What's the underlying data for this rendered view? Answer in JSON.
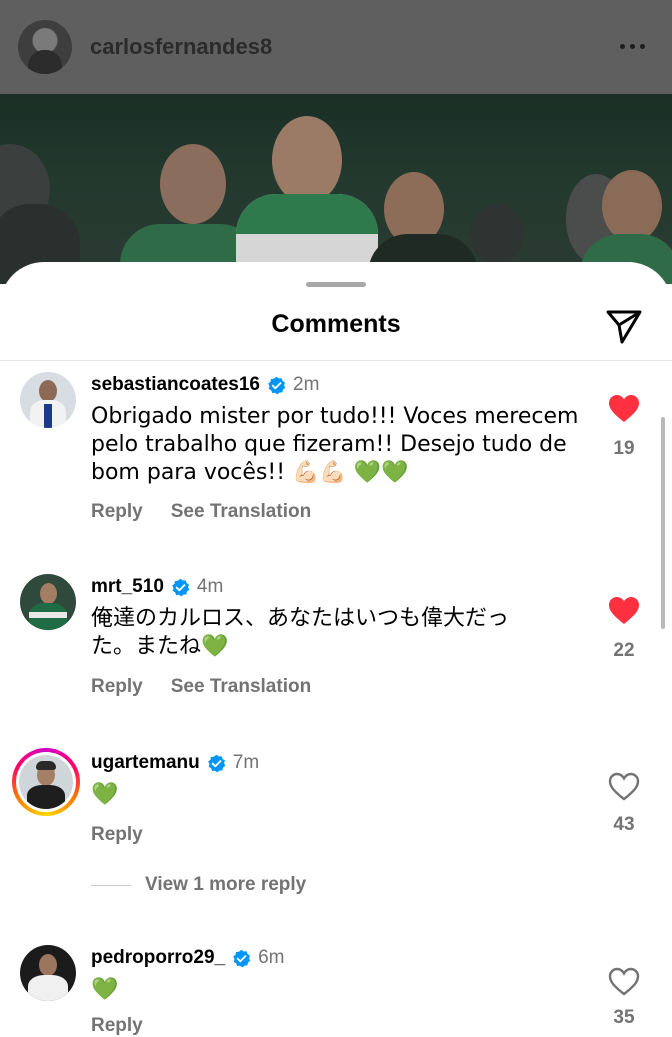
{
  "post": {
    "username": "carlosfernandes8",
    "more_icon": "more-horizontal-icon"
  },
  "sheet": {
    "title": "Comments",
    "share_icon": "send-icon"
  },
  "colors": {
    "like_red": "#ff3040",
    "verified_blue": "#0095f6",
    "secondary_text": "#737373"
  },
  "comments": [
    {
      "username": "sebastiancoates16",
      "verified": true,
      "time": "2m",
      "text_lines": [
        "Obrigado mister por tudo!!! Voces merecem",
        "pelo trabalho que fizeram!! Desejo tudo de",
        "bom para vocês!! 💪🏻💪🏻 💚💚"
      ],
      "reply_label": "Reply",
      "translate_label": "See Translation",
      "liked": true,
      "likes": "19"
    },
    {
      "username": "mrt_510",
      "verified": true,
      "time": "4m",
      "text_lines": [
        "俺達のカルロス、あなたはいつも偉大だっ",
        "た。またね💚"
      ],
      "reply_label": "Reply",
      "translate_label": "See Translation",
      "liked": true,
      "likes": "22"
    },
    {
      "username": "ugartemanu",
      "verified": true,
      "time": "7m",
      "text_lines": [
        "💚"
      ],
      "reply_label": "Reply",
      "liked": false,
      "likes": "43",
      "view_replies": "View 1 more reply"
    },
    {
      "username": "pedroporro29_",
      "verified": true,
      "time": "6m",
      "text_lines": [
        "💚"
      ],
      "reply_label": "Reply",
      "liked": false,
      "likes": "35"
    }
  ]
}
